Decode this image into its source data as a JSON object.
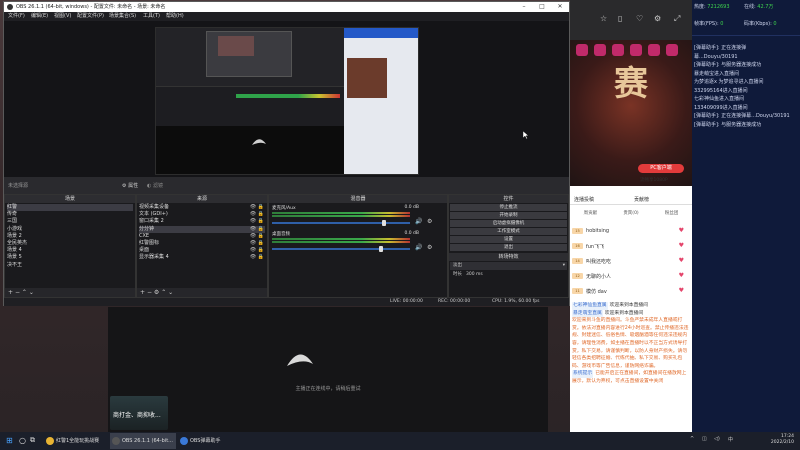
{
  "obs": {
    "title": "OBS 26.1.1 (64-bit, windows) - 配置文件: 未命名 - 场景: 未命名",
    "menu": [
      "文件(F)",
      "编辑(E)",
      "视图(V)",
      "配置文件(P)",
      "场景集合(S)",
      "工具(T)",
      "帮助(H)"
    ],
    "no_source_label": "未选择源",
    "properties_label": "属性",
    "filters_label": "滤镜",
    "scenes": {
      "header": "场景",
      "items": [
        "红警",
        "传奇",
        "三国",
        "小游戏",
        "场景 2",
        "全民英杰",
        "场景 4",
        "场景 5",
        "决不王"
      ],
      "selected_index": 0
    },
    "sources": {
      "header": "来源",
      "items": [
        "视频采集设备",
        "文本 (GDI+)",
        "窗口采集 2",
        "分分钟",
        "CXE",
        "红警图标",
        "桌面",
        "显示器采集 4"
      ],
      "selected_index": 3
    },
    "mixer": {
      "header": "混音器",
      "channels": [
        {
          "name": "麦克风/Aux",
          "db": "0.0 dB",
          "level": 0.82
        },
        {
          "name": "桌面音频",
          "db": "0.0 dB",
          "level": 0.8
        }
      ]
    },
    "controls": {
      "header": "控件",
      "buttons": [
        "停止推流",
        "开始录制",
        "启动虚拟摄像机",
        "工作室模式",
        "设置",
        "退出"
      ]
    },
    "transitions": {
      "header": "转场特效",
      "value": "淡出",
      "duration_label": "时长",
      "duration_value": "300 ms"
    },
    "status": {
      "live": "LIVE: 00:00:00",
      "rec": "REC: 00:00:00",
      "cpu": "CPU: 1.9%, 60.00 fps"
    },
    "preview_message": "主播正在连线中，请稍后重试"
  },
  "right_panel": {
    "stats": [
      {
        "label": "热度:",
        "value": "7212693"
      },
      {
        "label": "在线:",
        "value": "42.7万"
      },
      {
        "label": "帧率(FPS):",
        "value": "0"
      },
      {
        "label": "码率(Kbps):",
        "value": "0"
      }
    ],
    "logs": [
      "[弹幕助手]: 正在连接弹",
      "幕...Douyu/30191",
      "[弹幕助手]: 与服务器连接成功",
      "暴走萌宝进入直播间",
      "为梦追逐x 为梦追寻进入直播间",
      "332995164进入直播间",
      "七彩神仙鱼进入直播间",
      "133409099进入直播间",
      "",
      "",
      "",
      "",
      "[弹幕助手]: 正在连接弹幕...Douyu/30191",
      "[弹幕助手]: 与服务器连接成功"
    ]
  },
  "live_page": {
    "banner_text": "赛",
    "pc_button": "PC客户端",
    "pc_sub": "流畅享1080P",
    "tabs": [
      "连播投稿",
      "贡献榜"
    ],
    "subtabs": [
      "周贡献",
      "贵宾(0)",
      "粉丝团"
    ],
    "fans": [
      {
        "level": "15",
        "name": "hobitsing"
      },
      {
        "level": "16",
        "name": "fun飞飞"
      },
      {
        "level": "14",
        "name": "叫我还吃吃"
      },
      {
        "level": "12",
        "name": "无聊的小人"
      },
      {
        "level": "11",
        "name": "模仿 dav"
      }
    ],
    "messages": [
      {
        "tag": "七彩神仙鱼直属",
        "text": "欢迎来到本直播间"
      },
      {
        "tag": "暴走萌宝直属",
        "text": "欢迎来到本直播间"
      },
      {
        "tag": "",
        "text": "欢迎来到斗鱼的直播间。斗鱼严禁未成年人直播或打赏。依法对直播内容进行24小时巡查。禁止传播违法违规、封建迷信、低俗色情、吸烟酗酒等任何违法违规内容，请理性消费，如主播在直播时以不正当方式诱导打赏，私下交易，请谨慎判断，以防人身财产损失。请勿轻信各类招聘征婚、代练代抽、私下交易、购买礼包码、游戏币等广告信息，谨防网络诈骗。"
      },
      {
        "tag": "系统提示",
        "text": "已能开启正在直播间，如直播间在播放网上展示，默认为弃权，可点击直播设置中关闭"
      }
    ]
  },
  "bottom_preview_message": "主播正在连线中，请稍后重试",
  "ad_text": "商打金、商抑收...",
  "taskbar": {
    "items": [
      {
        "label": "红警1全能玩挑战赛"
      },
      {
        "label": "OBS 26.1.1 (64-bit..."
      },
      {
        "label": "OBS弹幕助手"
      }
    ],
    "active_index": 1,
    "time": "17:24",
    "date": "2022/2/10"
  }
}
